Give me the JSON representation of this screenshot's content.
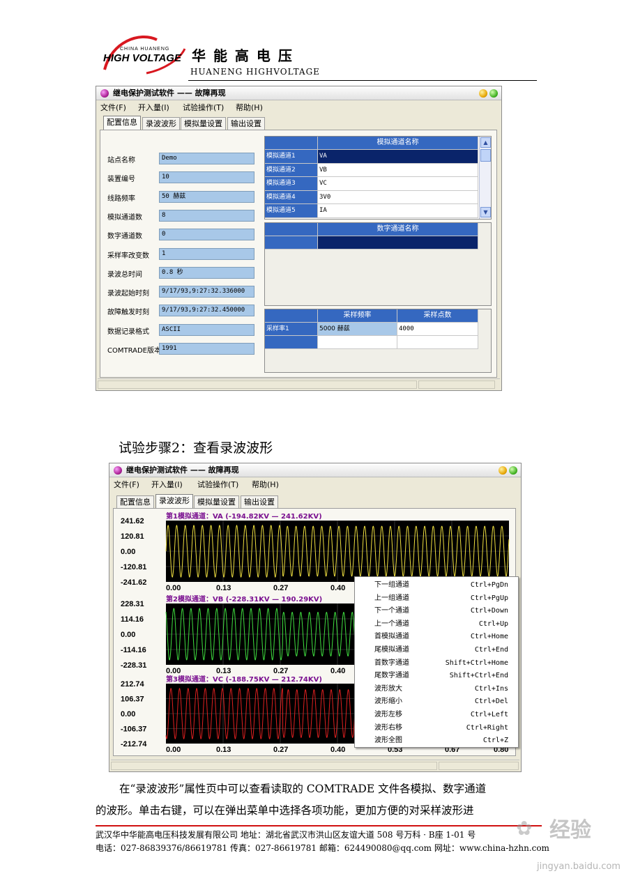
{
  "header": {
    "logo_small": "CHINA HUANENG",
    "logo_main": "HIGH VOLTAGE",
    "company_cn": "华 能 高 电 压",
    "company_en": "HUANENG HIGHVOLTAGE"
  },
  "window1": {
    "title": "继电保护测试软件 —— 故障再现",
    "menu": [
      "文件(F)",
      "开入量(I)",
      "试验操作(T)",
      "帮助(H)"
    ],
    "tabs": [
      "配置信息",
      "录波波形",
      "模拟量设置",
      "输出设置"
    ],
    "active_tab": 0,
    "fields": [
      {
        "label": "站点名称",
        "value": "Demo"
      },
      {
        "label": "装置编号",
        "value": "10"
      },
      {
        "label": "线路频率",
        "value": "50 赫兹"
      },
      {
        "label": "模拟通道数",
        "value": "8"
      },
      {
        "label": "数字通道数",
        "value": "0"
      },
      {
        "label": "采样率改变数",
        "value": "1"
      },
      {
        "label": "录波总时间",
        "value": "0.8 秒"
      },
      {
        "label": "录波起始时刻",
        "value": "9/17/93,9:27:32.336000"
      },
      {
        "label": "故障触发时刻",
        "value": "9/17/93,9:27:32.450000"
      },
      {
        "label": "数据记录格式",
        "value": "ASCII"
      },
      {
        "label": "COMTRADE版本",
        "value": "1991"
      }
    ],
    "analog_grid": {
      "header": "模拟通道名称",
      "rows": [
        {
          "label": "模拟通道1",
          "value": "VA"
        },
        {
          "label": "模拟通道2",
          "value": "VB"
        },
        {
          "label": "模拟通道3",
          "value": "VC"
        },
        {
          "label": "模拟通道4",
          "value": "3V0"
        },
        {
          "label": "模拟通道5",
          "value": "IA"
        }
      ]
    },
    "digital_grid": {
      "header": "数字通道名称"
    },
    "sample_grid": {
      "headers": [
        "采样频率",
        "采样点数"
      ],
      "rows": [
        {
          "label": "采样率1",
          "freq": "5000 赫兹",
          "points": "4000"
        }
      ]
    }
  },
  "step_heading": "试验步骤2：查看录波波形",
  "window2": {
    "title": "继电保护测试软件 —— 故障再现",
    "menu": [
      "文件(F)",
      "开入量(I)",
      "试验操作(T)",
      "帮助(H)"
    ],
    "tabs": [
      "配置信息",
      "录波波形",
      "模拟量设置",
      "输出设置"
    ],
    "active_tab": 1,
    "channels": [
      {
        "title": "第1模拟通道：VA  (-194.82KV — 241.62KV)",
        "color": "#f0e040",
        "yticks": [
          "241.62",
          "120.81",
          "0.00",
          "-120.81",
          "-241.62"
        ]
      },
      {
        "title": "第2模拟通道：VB  (-228.31KV — 190.29KV)",
        "color": "#40e040",
        "yticks": [
          "228.31",
          "114.16",
          "0.00",
          "-114.16",
          "-228.31"
        ]
      },
      {
        "title": "第3模拟通道：VC  (-188.75KV — 212.74KV)",
        "color": "#e02020",
        "yticks": [
          "212.74",
          "106.37",
          "0.00",
          "-106.37",
          "-212.74"
        ]
      }
    ],
    "xticks_visible": [
      "0.00",
      "0.13",
      "0.27",
      "0.40"
    ],
    "xticks_bottom": [
      "0.00",
      "0.13",
      "0.27",
      "0.40",
      "0.53",
      "0.67",
      "0.80"
    ],
    "context_menu": [
      {
        "label": "下一组通道",
        "shortcut": "Ctrl+PgDn"
      },
      {
        "label": "上一组通道",
        "shortcut": "Ctrl+PgUp"
      },
      {
        "label": "下一个通道",
        "shortcut": "Ctrl+Down"
      },
      {
        "label": "上一个通道",
        "shortcut": "Ctrl+Up"
      },
      {
        "label": "首模拟通道",
        "shortcut": "Ctrl+Home"
      },
      {
        "label": "尾模拟通道",
        "shortcut": "Ctrl+End"
      },
      {
        "label": "首数字通道",
        "shortcut": "Shift+Ctrl+Home"
      },
      {
        "label": "尾数字通道",
        "shortcut": "Shift+Ctrl+End"
      },
      {
        "label": "波形放大",
        "shortcut": "Ctrl+Ins"
      },
      {
        "label": "波形缩小",
        "shortcut": "Ctrl+Del"
      },
      {
        "label": "波形左移",
        "shortcut": "Ctrl+Left"
      },
      {
        "label": "波形右移",
        "shortcut": "Ctrl+Right"
      },
      {
        "label": "波形全图",
        "shortcut": "Ctrl+Z"
      }
    ]
  },
  "paragraph": {
    "line1": "在“录波波形”属性页中可以查看读取的 COMTRADE 文件各模拟、数字通道",
    "line2": "的波形。单击右键，可以在弹出菜单中选择各项功能，更加方便的对采样波形进"
  },
  "footer": {
    "line1": "武汉华中华能高电压科技发展有限公司 地址：湖北省武汉市洪山区友谊大道 508 号万科 ·  B座 1-01 号",
    "line2": "电话：027-86839376/86619781 传真：027-86619781 邮箱：624490080@qq.com    网址：www.china-hzhn.com"
  },
  "watermark": {
    "brand": "经验",
    "url": "jingyan.baidu.com"
  }
}
